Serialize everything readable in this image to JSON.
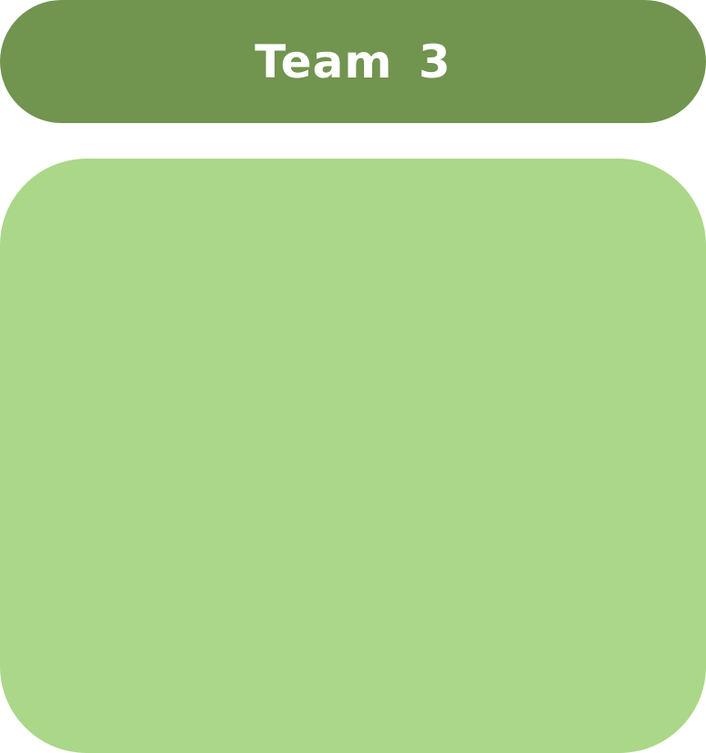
{
  "header": {
    "title": "Team 3"
  },
  "colors": {
    "header_background": "#71944f",
    "panel_background": "#abd788",
    "title_text": "#ffffff"
  }
}
